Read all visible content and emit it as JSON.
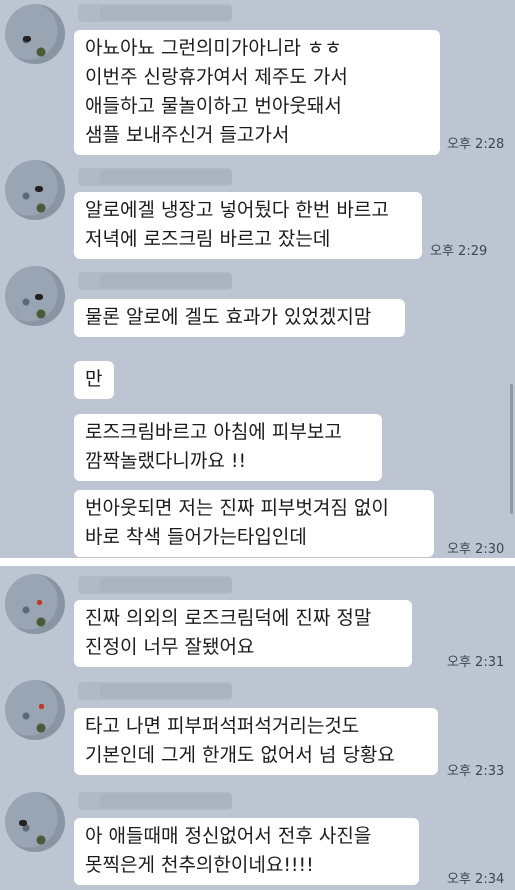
{
  "conversation": [
    {
      "time": "오후 2:28",
      "lines": [
        "아뇨아뇨 그런의미가아니라 ㅎㅎ",
        "이번주 신랑휴가여서 제주도 가서",
        "애들하고 물놀이하고 번아웃돼서",
        "샘플 보내주신거 들고가서"
      ]
    },
    {
      "time": "오후 2:29",
      "lines": [
        "알로에겔 냉장고 넣어뒀다 한번 바르고",
        "저녁에 로즈크림 바르고 잤는데"
      ]
    },
    {
      "bubbles": [
        {
          "lines": [
            "물론 알로에 겔도 효과가 있었겠지맘"
          ]
        },
        {
          "lines": [
            "만"
          ]
        },
        {
          "lines": [
            "로즈크림바르고 아침에 피부보고",
            "깜짝놀랬다니까요 !!"
          ]
        },
        {
          "lines": [
            "번아웃되면 저는 진짜 피부벗겨짐 없이",
            "바로 착색 들어가는타입인데"
          ]
        }
      ],
      "time": "오후 2:30"
    },
    {
      "time": "오후 2:31",
      "lines": [
        "진짜 의외의 로즈크림덕에 진짜 정말",
        "진정이 너무 잘됐어요"
      ]
    },
    {
      "time": "오후 2:33",
      "lines": [
        "타고 나면 피부퍼석퍼석거리는것도",
        "기본인데 그게 한개도 없어서 넘 당황요"
      ]
    },
    {
      "time": "오후 2:34",
      "lines": [
        "아 애들때매 정신없어서 전후 사진을",
        "못찍은게 천추의한이네요!!!!"
      ]
    }
  ],
  "colors": {
    "chat_background": "#bcc5d1",
    "bubble": "#ffffff",
    "text": "#1c1c1c",
    "time": "#3d4654"
  }
}
